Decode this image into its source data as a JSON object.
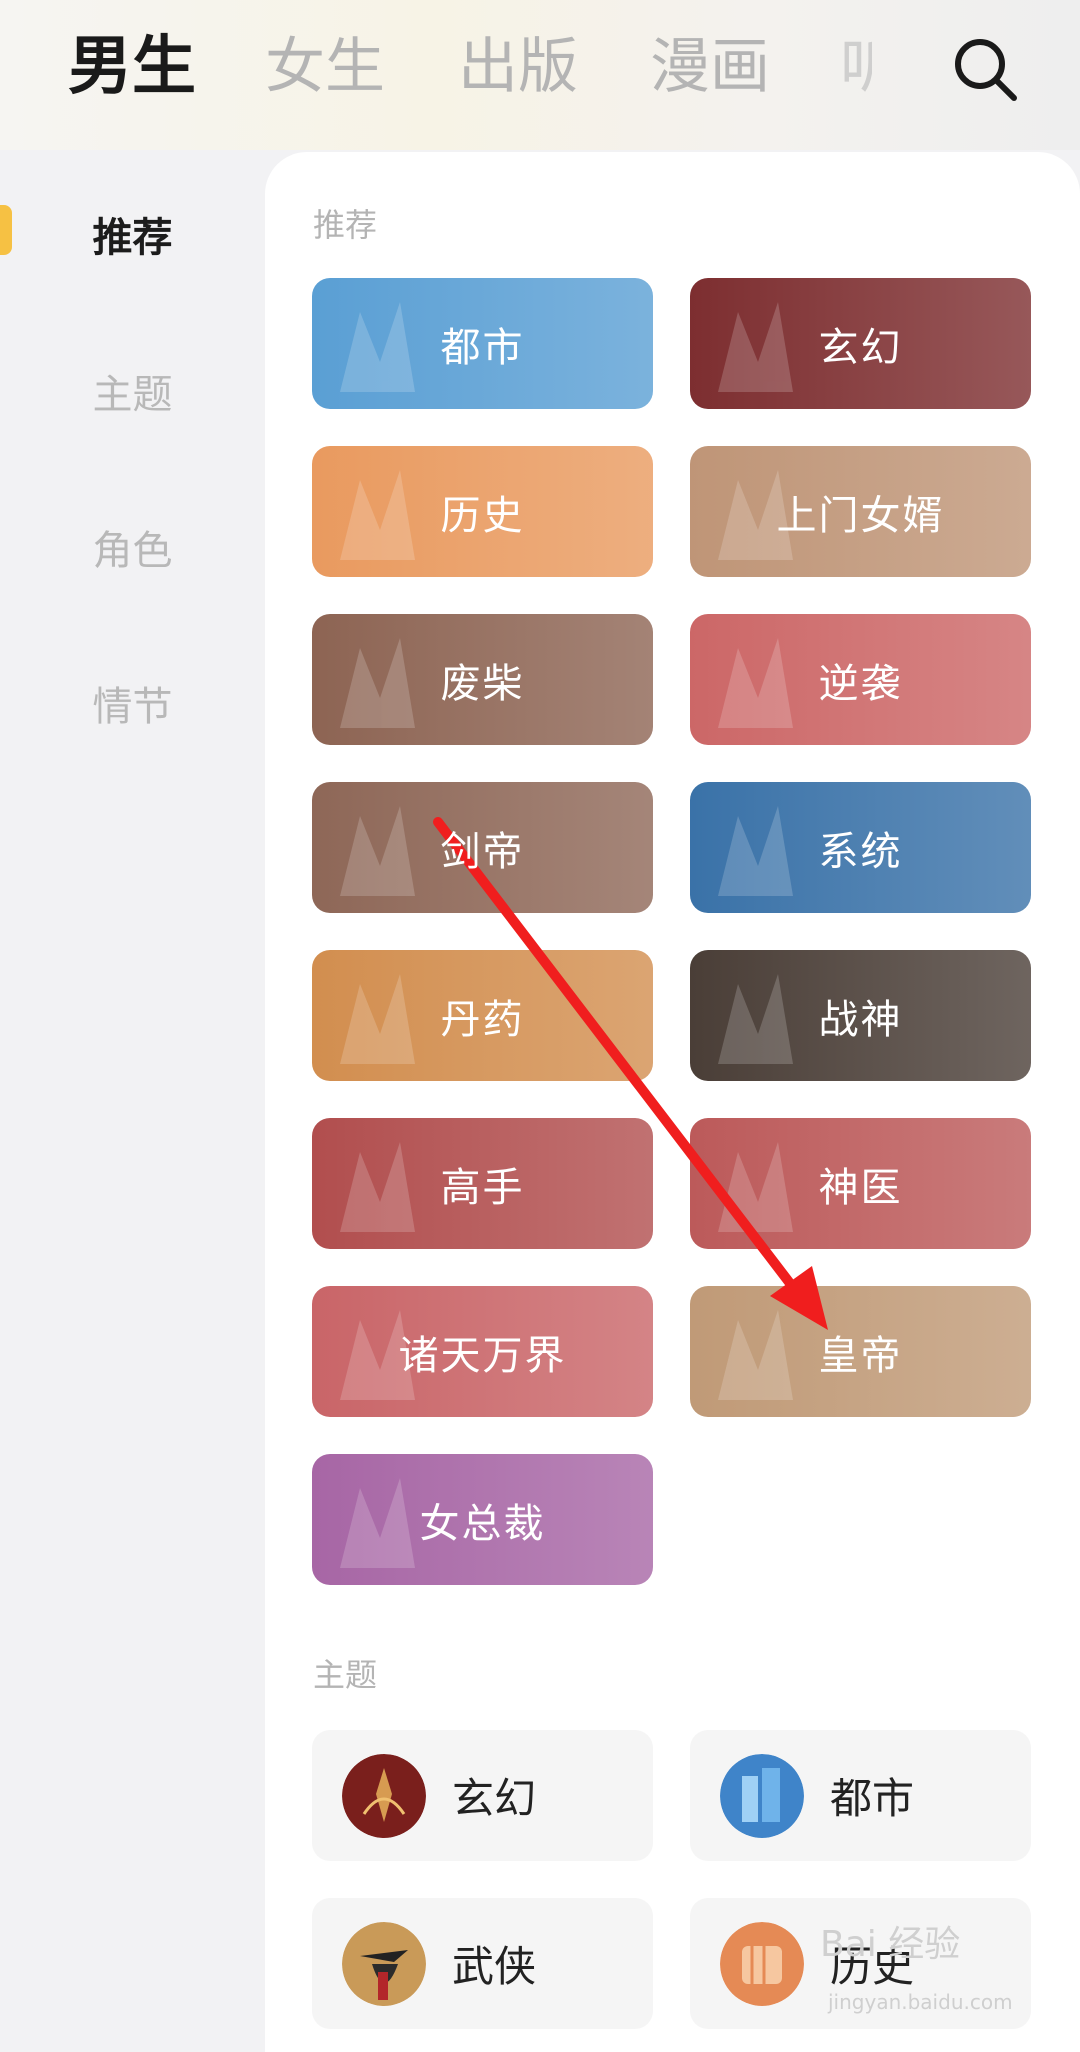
{
  "tabs": [
    {
      "label": "男生",
      "active": true
    },
    {
      "label": "女生",
      "active": false
    },
    {
      "label": "出版",
      "active": false
    },
    {
      "label": "漫画",
      "active": false
    },
    {
      "label": "听",
      "active": false
    }
  ],
  "sidebar": {
    "items": [
      {
        "label": "推荐",
        "active": true
      },
      {
        "label": "主题",
        "active": false
      },
      {
        "label": "角色",
        "active": false
      },
      {
        "label": "情节",
        "active": false
      }
    ]
  },
  "sections": {
    "recommend_title": "推荐",
    "theme_title": "主题"
  },
  "recommend_tiles": [
    {
      "label": "都市",
      "color": "#5a9fd4"
    },
    {
      "label": "玄幻",
      "color": "#7d2e30"
    },
    {
      "label": "历史",
      "color": "#e99a5f"
    },
    {
      "label": "上门女婿",
      "color": "#bf9577"
    },
    {
      "label": "废柴",
      "color": "#8d6453"
    },
    {
      "label": "逆袭",
      "color": "#cc6767"
    },
    {
      "label": "剑帝",
      "color": "#8e6757"
    },
    {
      "label": "系统",
      "color": "#3a72a8"
    },
    {
      "label": "丹药",
      "color": "#d28e4f"
    },
    {
      "label": "战神",
      "color": "#4a3e37"
    },
    {
      "label": "高手",
      "color": "#b14e4e"
    },
    {
      "label": "神医",
      "color": "#bc5a5a"
    },
    {
      "label": "诸天万界",
      "color": "#c96568"
    },
    {
      "label": "皇帝",
      "color": "#c09a77"
    },
    {
      "label": "女总裁",
      "color": "#a766a5"
    }
  ],
  "theme_cards": [
    {
      "label": "玄幻",
      "avatar_color": "#7a1f1c"
    },
    {
      "label": "都市",
      "avatar_color": "#3f84c9"
    },
    {
      "label": "武侠",
      "avatar_color": "#c99a58"
    },
    {
      "label": "历史",
      "avatar_color": "#e58a55"
    }
  ],
  "watermark": {
    "text": "Bai 经验",
    "sub": "jingyan.baidu.com"
  },
  "colors": {
    "accent": "#f6c143",
    "annotation_arrow": "#f01e1e"
  }
}
